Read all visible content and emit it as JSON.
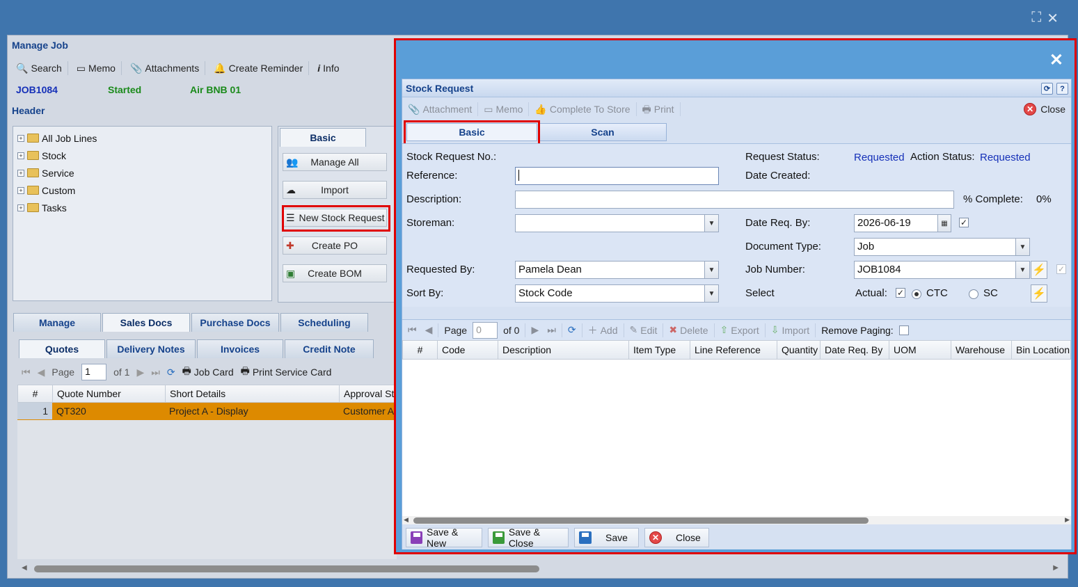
{
  "background": {
    "window_title": "Manage Job",
    "toolbar": [
      {
        "label": "Search",
        "icon": "search-icon"
      },
      {
        "label": "Memo",
        "icon": "memo-icon"
      },
      {
        "label": "Attachments",
        "icon": "paperclip-icon"
      },
      {
        "label": "Create Reminder",
        "icon": "bell-icon"
      },
      {
        "label": "Info",
        "icon": "info-icon"
      }
    ],
    "job": {
      "number": "JOB1084",
      "status": "Started",
      "customer": "Air BNB 01"
    },
    "section_header": "Header",
    "tree": [
      "All Job Lines",
      "Stock",
      "Service",
      "Custom",
      "Tasks"
    ],
    "panel_tab": "Basic",
    "buttons": [
      "Manage All",
      "Import",
      "New Stock Request",
      "Create PO",
      "Create BOM"
    ],
    "main_tabs": [
      "Manage",
      "Sales Docs",
      "Purchase Docs",
      "Scheduling"
    ],
    "sub_tabs": [
      "Quotes",
      "Delivery Notes",
      "Invoices",
      "Credit Note"
    ],
    "pager": {
      "page_label": "Page",
      "page": "1",
      "of": "of 1",
      "job_card": "Job Card",
      "print_service_card": "Print Service Card"
    },
    "grid_columns": [
      "#",
      "Quote Number",
      "Short Details",
      "Approval St"
    ],
    "grid_rows": [
      {
        "num": "1",
        "quote": "QT320",
        "details": "Project A - Display",
        "approval": "Customer A"
      }
    ]
  },
  "modal": {
    "title": "Stock Request",
    "toolbar": [
      {
        "label": "Attachment",
        "icon": "paperclip-icon"
      },
      {
        "label": "Memo",
        "icon": "memo-icon"
      },
      {
        "label": "Complete To Store",
        "icon": "thumbs-up-icon"
      },
      {
        "label": "Print",
        "icon": "printer-icon"
      }
    ],
    "close_label": "Close",
    "tabs": [
      "Basic",
      "Scan"
    ],
    "form": {
      "stock_request_no_label": "Stock Request No.:",
      "reference_label": "Reference:",
      "description_label": "Description:",
      "storeman_label": "Storeman:",
      "requested_by_label": "Requested By:",
      "requested_by_value": "Pamela Dean",
      "sort_by_label": "Sort By:",
      "sort_by_value": "Stock Code",
      "request_status_label": "Request Status:",
      "request_status_value": "Requested",
      "action_status_label": "Action Status:",
      "action_status_value": "Requested",
      "date_created_label": "Date Created:",
      "percent_complete_label": "% Complete:",
      "percent_complete_value": "0%",
      "date_req_by_label": "Date Req. By:",
      "date_req_by_value": "2026-06-19",
      "document_type_label": "Document Type:",
      "document_type_value": "Job",
      "job_number_label": "Job Number:",
      "job_number_value": "JOB1084",
      "select_label": "Select",
      "actual_label": "Actual:",
      "ctc_label": "CTC",
      "sc_label": "SC"
    },
    "grid_toolbar": {
      "page_label": "Page",
      "page_value": "0",
      "of_label": "of 0",
      "add": "Add",
      "edit": "Edit",
      "delete": "Delete",
      "export": "Export",
      "import": "Import",
      "remove_paging": "Remove Paging:"
    },
    "grid_columns": [
      "#",
      "Code",
      "Description",
      "Item Type",
      "Line Reference",
      "Quantity",
      "Date Req. By",
      "UOM",
      "Warehouse",
      "Bin Location"
    ],
    "footer_buttons": [
      "Save & New",
      "Save & Close",
      "Save",
      "Close"
    ]
  },
  "colors": {
    "accent": "#15428b",
    "status_blue": "#1530b8",
    "highlight_row": "#dd8a00",
    "annotation_red": "#e00000"
  }
}
